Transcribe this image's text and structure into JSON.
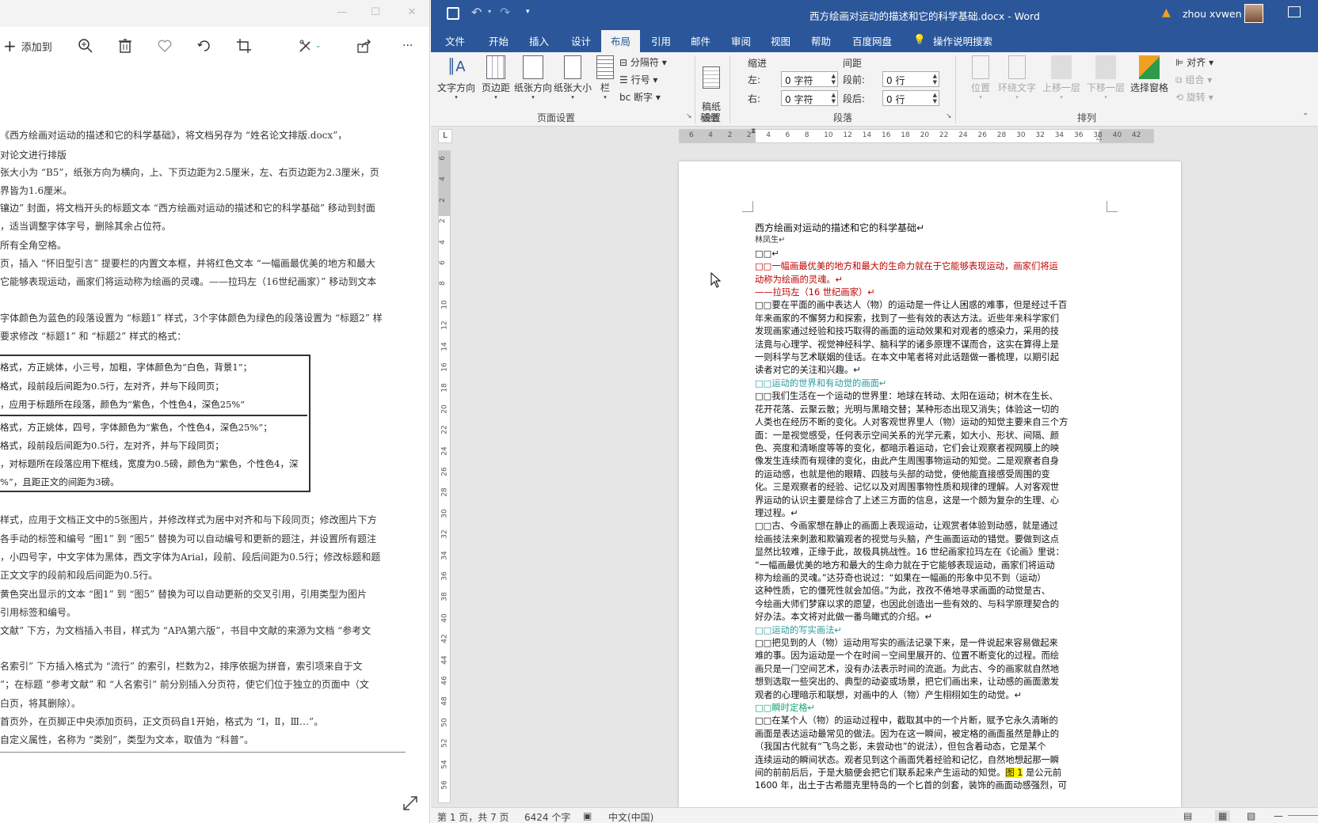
{
  "viewer": {
    "toolbar": {
      "add_to_label": "添加到",
      "add_icon": "plus-icon",
      "zoom_icon": "zoom-in-icon",
      "delete_icon": "trash-icon",
      "favorite_icon": "heart-icon",
      "rotate_icon": "rotate-icon",
      "crop_icon": "crop-icon",
      "edit_icon": "edit-enhance-icon",
      "share_icon": "share-icon",
      "more_label": "···"
    },
    "lines": [
      "《西方绘画对运动的描述和它的科学基础》，将文档另存为 “姓名论文排版.docx”，",
      "对论文进行排版",
      "张大小为 “B5”，纸张方向为横向，上、下页边距为2.5厘米，左、右页边距为2.3厘米，页",
      "界皆为1.6厘米。",
      "镶边” 封面，将文档开头的标题文本 “西方绘画对运动的描述和它的科学基础” 移动到封面",
      "，适当调整字体字号，删除其余占位符。",
      "所有全角空格。",
      "页，插入 “怀旧型引言” 提要栏的内置文本框，并将红色文本 “一幅画最优美的地方和最大",
      "它能够表现运动，画家们将运动称为绘画的灵魂。——拉玛左（16世纪画家）” 移动到文本",
      "字体颜色为蓝色的段落设置为 “标题1” 样式，3个字体颜色为绿色的段落设置为 “标题2” 样",
      "要求修改 “标题1” 和 “标题2” 样式的格式：",
      "样式，应用于文档正文中的5张图片，并修改样式为居中对齐和与下段同页；修改图片下方",
      "各手动的标签和编号 “图1” 到 “图5” 替换为可以自动编号和更新的题注，并设置所有题注",
      "，小四号字，中文字体为黑体，西文字体为Arial，段前、段后间距为0.5行；修改标题和题",
      "正文文字的段前和段后间距为0.5行。",
      "黄色突出显示的文本 “图1” 到 “图5” 替换为可以自动更新的交叉引用，引用类型为图片",
      "引用标签和编号。",
      "文献” 下方，为文档插入书目，样式为 “APA第六版”，书目中文献的来源为文档 “参考文",
      "名索引” 下方插入格式为 “流行” 的索引，栏数为2，排序依据为拼音，索引项来自于文",
      "”；在标题 “参考文献” 和 “人名索引” 前分别插入分页符，使它们位于独立的页面中（文",
      "白页，将其删除）。",
      "首页外，在页脚正中央添加页码，正文页码自1开始，格式为 “Ⅰ，Ⅱ，Ⅲ…”。",
      "自定义属性，名称为 “类别”，类型为文本，取值为 “科普”。"
    ],
    "box_lines": [
      "格式，方正姚体，小三号，加粗，字体颜色为“白色，背景1”；",
      "格式，段前段后间距为0.5行，左对齐，并与下段同页；",
      "，应用于标题所在段落，颜色为“紫色，个性色4，深色25%”",
      "格式，方正姚体，四号，字体颜色为“紫色，个性色4，深色25%”；",
      "格式，段前段后间距为0.5行，左对齐，并与下段同页；",
      "，对标题所在段落应用下框线，宽度为0.5磅，颜色为“紫色，个性色4，深",
      "%”，且距正文的间距为3磅。"
    ]
  },
  "word": {
    "title": "西方绘画对运动的描述和它的科学基础.docx  -  Word",
    "user": "zhou xvwen",
    "warning_icon": "warning-icon",
    "tabs": [
      "文件",
      "开始",
      "插入",
      "设计",
      "布局",
      "引用",
      "邮件",
      "审阅",
      "视图",
      "帮助",
      "百度网盘",
      "操作说明搜索"
    ],
    "active_tab": "布局",
    "ribbon": {
      "text_direction": "文字方向",
      "margins": "页边距",
      "orientation": "纸张方向",
      "size": "纸张大小",
      "columns": "栏",
      "breaks": "分隔符",
      "line_numbers": "行号",
      "hyphenation": "断字",
      "page_setup_group": "页面设置",
      "draft_paper": "稿纸\n设置",
      "draft_group": "稿纸",
      "indent_header": "缩进",
      "spacing_header": "间距",
      "indent_left_label": "左:",
      "indent_left_value": "0 字符",
      "indent_right_label": "右:",
      "indent_right_value": "0 字符",
      "space_before_label": "段前:",
      "space_before_value": "0 行",
      "space_after_label": "段后:",
      "space_after_value": "0 行",
      "paragraph_group": "段落",
      "position": "位置",
      "wrap_text": "环绕文字",
      "bring_forward": "上移一层",
      "send_backward": "下移一层",
      "selection_pane": "选择窗格",
      "align": "对齐",
      "group": "组合",
      "rotate": "旋转",
      "arrange_group": "排列"
    },
    "hruler_ticks": [
      "6",
      "4",
      "2",
      "2",
      "4",
      "6",
      "8",
      "10",
      "12",
      "14",
      "16",
      "18",
      "20",
      "22",
      "24",
      "26",
      "28",
      "30",
      "32",
      "34",
      "36",
      "38",
      "40",
      "42"
    ],
    "vruler_ticks": [
      "6",
      "4",
      "2",
      "2",
      "4",
      "6",
      "8",
      "10",
      "12",
      "14",
      "16",
      "18",
      "20",
      "22",
      "24",
      "26",
      "28",
      "30",
      "32",
      "34",
      "36",
      "38",
      "40",
      "42",
      "44",
      "46",
      "48",
      "50",
      "52",
      "54",
      "56"
    ],
    "doc": {
      "title": "西方绘画对运动的描述和它的科学基础↵",
      "author": "林凤生↵",
      "empty": "□□↵",
      "quote1": "□□一幅画最优美的地方和最大的生命力就在于它能够表现运动，画家们将运",
      "quote2": "动称为绘画的灵魂。↵",
      "quote3": "——拉玛左（16 世纪画家）↵",
      "para1": [
        "□□要在平面的画中表达人（物）的运动是一件让人困惑的难事，但是经过千百",
        "年来画家的不懈努力和探索，找到了一些有效的表达方法。近些年来科学家们",
        "发现画家通过经验和技巧取得的画面的运动效果和对观者的感染力，采用的技",
        "法竟与心理学、视觉神经科学、脑科学的诸多原理不谋而合，这实在算得上是",
        "一则科学与艺术联姻的佳话。在本文中笔者将对此话题做一番梳理，以期引起",
        "读者对它的关注和兴趣。↵"
      ],
      "h1a": "□□运动的世界和有动觉的画面↵",
      "para2": [
        "□□我们生活在一个运动的世界里：地球在转动、太阳在运动；树木在生长、",
        "花开花落、云聚云散；光明与黑暗交替；某种形态出现又消失；体验这一切的",
        "人类也在经历不断的变化。人对客观世界里人（物）运动的知觉主要来自三个方",
        "面：一是视觉感受，任何表示空间关系的光学元素，如大小、形状、间隔、颜",
        "色、亮度和清晰度等等的变化，都暗示着运动，它们会让观察者视网膜上的映",
        "像发生连续而有规律的变化，由此产生周围事物运动的知觉。二是观察者自身",
        "的运动感，也就是他的眼睛、四肢与头部的动觉，使他能直接感受周围的变",
        "化。三是观察者的经验、记忆以及对周围事物性质和规律的理解。人对客观世",
        "界运动的认识主要是综合了上述三方面的信息，这是一个颇为复杂的生理、心",
        "理过程。↵"
      ],
      "para3": [
        "□□古、今画家想在静止的画面上表现运动，让观赏者体验到动感，就是通过",
        "绘画技法来刺激和欺骗观者的视觉与头脑，产生画面运动的错觉。要做到这点",
        "显然比较难，正缘于此，故极具挑战性。16 世纪画家拉玛左在《论画》里说：",
        "“一幅画最优美的地方和最大的生命力就在于它能够表现运动，画家们将运动",
        "称为绘画的灵魂。”达芬奇也说过：“如果在一幅画的形象中见不到（运动）",
        "这种性质，它的僵死性就会加倍。”为此，孜孜不倦地寻求画面的动觉是古、",
        "今绘画大师们梦寐以求的愿望，也因此创造出一些有效的、与科学原理契合的",
        "好办法。本文将对此做一番鸟瞰式的介绍。↵"
      ],
      "h2a": "□□运动的写实画法↵",
      "para4": [
        "□□把见到的人（物）运动用写实的画法记录下来，是一件说起来容易做起来",
        "难的事。因为运动是一个在时间－空间里展开的、位置不断变化的过程。而绘",
        "画只是一门空间艺术，没有办法表示时间的流逝。为此古、今的画家就自然地",
        "想到选取一些突出的、典型的动姿或场景，把它们画出来，让动感的画面激发",
        "观者的心理暗示和联想，对画中的人（物）产生栩栩如生的动觉。↵"
      ],
      "h2b": "□□瞬时定格↵",
      "para5": [
        "□□在某个人（物）的运动过程中，截取其中的一个片断，赋予它永久清晰的",
        "画面是表达运动最常见的做法。因为在这一瞬间，被定格的画面虽然是静止的",
        "（我国古代就有“飞鸟之影，未尝动也”的说法），但包含着动态，它是某个",
        "连续运动的瞬间状态。观者见到这个画面凭着经验和记忆，自然地想起那一瞬"
      ],
      "para5_last_a": "间的前前后后，于是大脑便会把它们联系起来产生运动的知觉。",
      "para5_hl": "图 1",
      "para5_last_b": " 是公元前",
      "para5_end": "1600 年，出土于古希腊克里特岛的一个匕首的剑套，装饰的画面动感强烈，可"
    },
    "status": {
      "page": "第 1 页，共 7 页",
      "words": "6424 个字",
      "language": "中文(中国)"
    }
  }
}
